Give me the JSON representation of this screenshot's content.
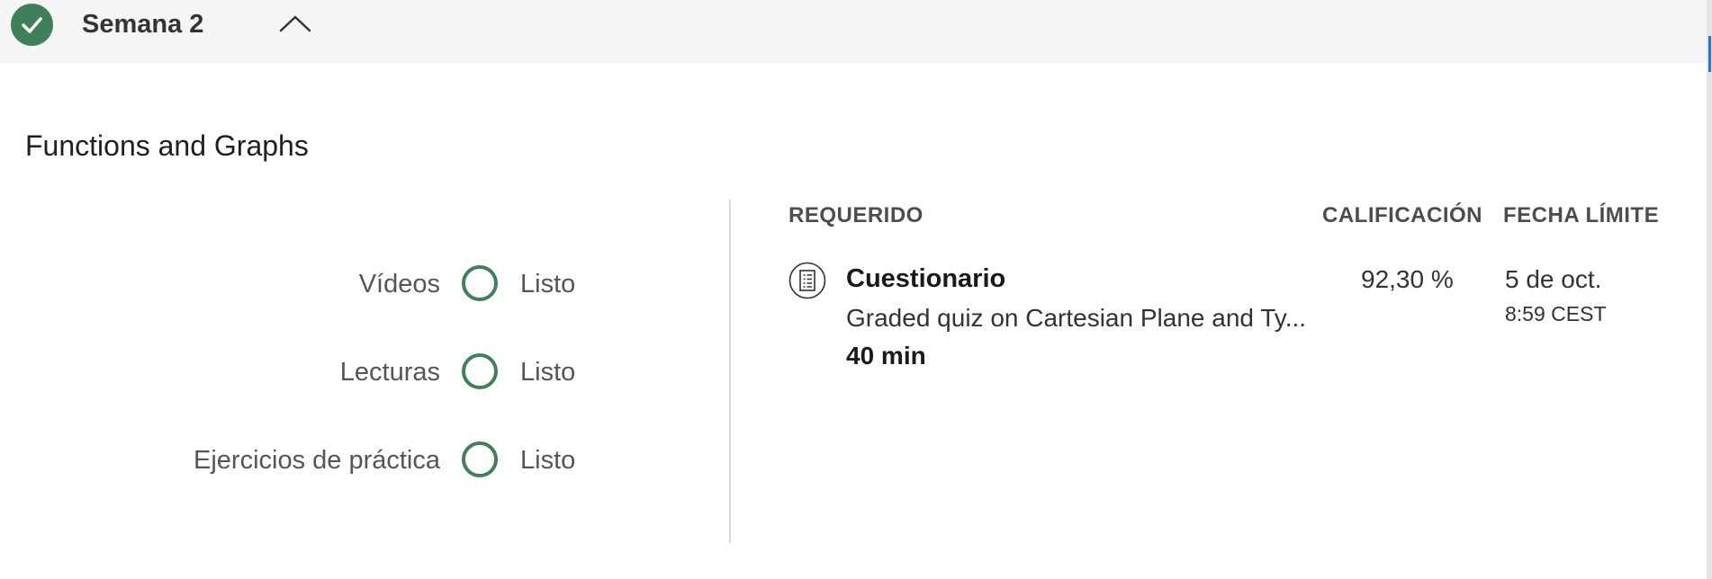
{
  "week": {
    "title": "Semana 2",
    "status_icon": "check-circle-icon",
    "toggle_icon": "chevron-up-icon"
  },
  "module": {
    "title": "Functions and Graphs"
  },
  "progress": [
    {
      "label": "Vídeos",
      "status": "Listo"
    },
    {
      "label": "Lecturas",
      "status": "Listo"
    },
    {
      "label": "Ejercicios de práctica",
      "status": "Listo"
    }
  ],
  "table": {
    "headers": {
      "required": "REQUERIDO",
      "grade": "CALIFICACIÓN",
      "due": "FECHA LÍMITE"
    },
    "items": [
      {
        "icon": "quiz-document-icon",
        "type": "Cuestionario",
        "name": "Graded quiz on Cartesian Plane and Ty...",
        "duration": "40 min",
        "grade": "92,30 %",
        "due_date": "5 de oct.",
        "due_time": "8:59 CEST"
      }
    ]
  },
  "colors": {
    "accent_green": "#3f7f5a",
    "header_bg": "#f5f5f5",
    "divider": "#d9d9d9"
  }
}
